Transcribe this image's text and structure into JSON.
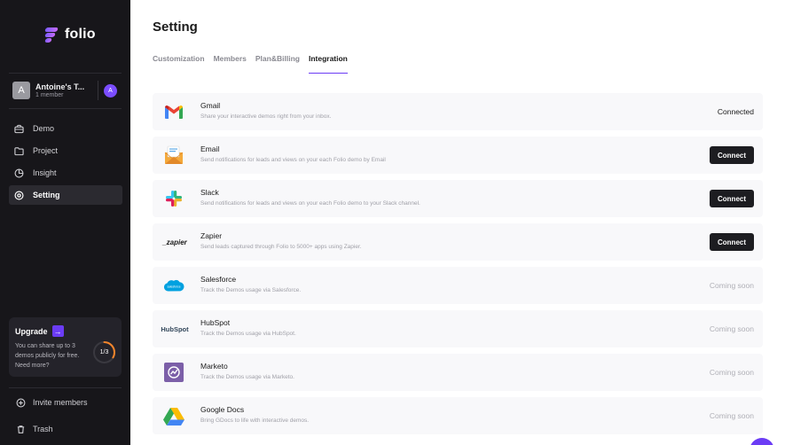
{
  "app": {
    "logo_text": "folio"
  },
  "workspace": {
    "avatar_letter": "A",
    "name": "Antoine's T...",
    "members": "1 member",
    "user_initial": "A"
  },
  "nav": [
    {
      "label": "Demo",
      "icon": "briefcase-icon",
      "active": false
    },
    {
      "label": "Project",
      "icon": "folder-icon",
      "active": false
    },
    {
      "label": "Insight",
      "icon": "pie-chart-icon",
      "active": false
    },
    {
      "label": "Setting",
      "icon": "gear-icon",
      "active": true
    }
  ],
  "upgrade": {
    "title": "Upgrade",
    "text": "You can share up to 3 demos publicly for free. Need more?",
    "usage_label": "1/3",
    "usage_fraction": 0.333,
    "accent": "#f5852b"
  },
  "bottom": {
    "invite_label": "Invite members",
    "trash_label": "Trash"
  },
  "page": {
    "title": "Setting"
  },
  "tabs": [
    {
      "label": "Customization",
      "active": false
    },
    {
      "label": "Members",
      "active": false
    },
    {
      "label": "Plan&Billing",
      "active": false
    },
    {
      "label": "Integration",
      "active": true
    }
  ],
  "integrations": [
    {
      "name": "Gmail",
      "desc": "Share your interactive demos right from your inbox.",
      "status": "Connected",
      "icon": "gmail-icon"
    },
    {
      "name": "Email",
      "desc": "Send notifications for leads and views on your each Folio demo by Email",
      "status": "Connect",
      "icon": "email-icon"
    },
    {
      "name": "Slack",
      "desc": "Send notifications for leads and views on your each Folio demo to your Slack channel.",
      "status": "Connect",
      "icon": "slack-icon"
    },
    {
      "name": "Zapier",
      "desc": "Send leads captured through Folio to 5000+ apps using Zapier.",
      "status": "Connect",
      "icon": "zapier-icon",
      "logo_text": "_zapier"
    },
    {
      "name": "Salesforce",
      "desc": "Track the Demos usage via Salesforce.",
      "status": "Coming soon",
      "icon": "salesforce-icon",
      "logo_text": "salesforce"
    },
    {
      "name": "HubSpot",
      "desc": "Track the Demos usage via HubSpot.",
      "status": "Coming soon",
      "icon": "hubspot-icon",
      "logo_text": "HubSpot"
    },
    {
      "name": "Marketo",
      "desc": "Track the Demos usage via Marketo.",
      "status": "Coming soon",
      "icon": "marketo-icon"
    },
    {
      "name": "Google Docs",
      "desc": "Bring GDocs to life with interactive demos.",
      "status": "Coming soon",
      "icon": "google-drive-icon"
    }
  ],
  "colors": {
    "accent": "#6b3cf5",
    "sidebar_bg": "#17161a"
  }
}
